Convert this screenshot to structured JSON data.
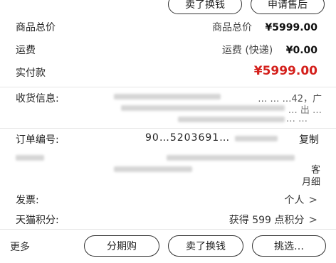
{
  "top_actions": {
    "sell": "卖了换钱",
    "after_sale": "申请售后"
  },
  "summary": {
    "goods_total": {
      "label": "商品总价",
      "right_label": "商品总价",
      "currency": "¥",
      "amount": "5999.00"
    },
    "shipping": {
      "label": "运费",
      "right_label": "运费 (快递)",
      "currency": "¥",
      "amount": "0.00"
    },
    "paid": {
      "label": "实付款",
      "currency": "¥",
      "amount": "5999.00"
    }
  },
  "receiver": {
    "label": "收货信息:",
    "line1": "… …   …42，广",
    "line2": "… 出 …",
    "line3": "… …"
  },
  "order": {
    "label": "订单编号:",
    "value": "90…5203691…",
    "copy": "复制"
  },
  "detail": {
    "suffix1": "客",
    "suffix2": "月细"
  },
  "invoice": {
    "label": "发票:",
    "value": "个人"
  },
  "points": {
    "label": "天猫积分:",
    "value": "获得 599 点积分"
  },
  "bottom": {
    "more": "更多",
    "installment": "分期购",
    "sell": "卖了换钱",
    "pick": "挑选…"
  },
  "colors": {
    "accent_red": "#d4201c",
    "border": "#333333",
    "divider": "#e6e6e6"
  }
}
